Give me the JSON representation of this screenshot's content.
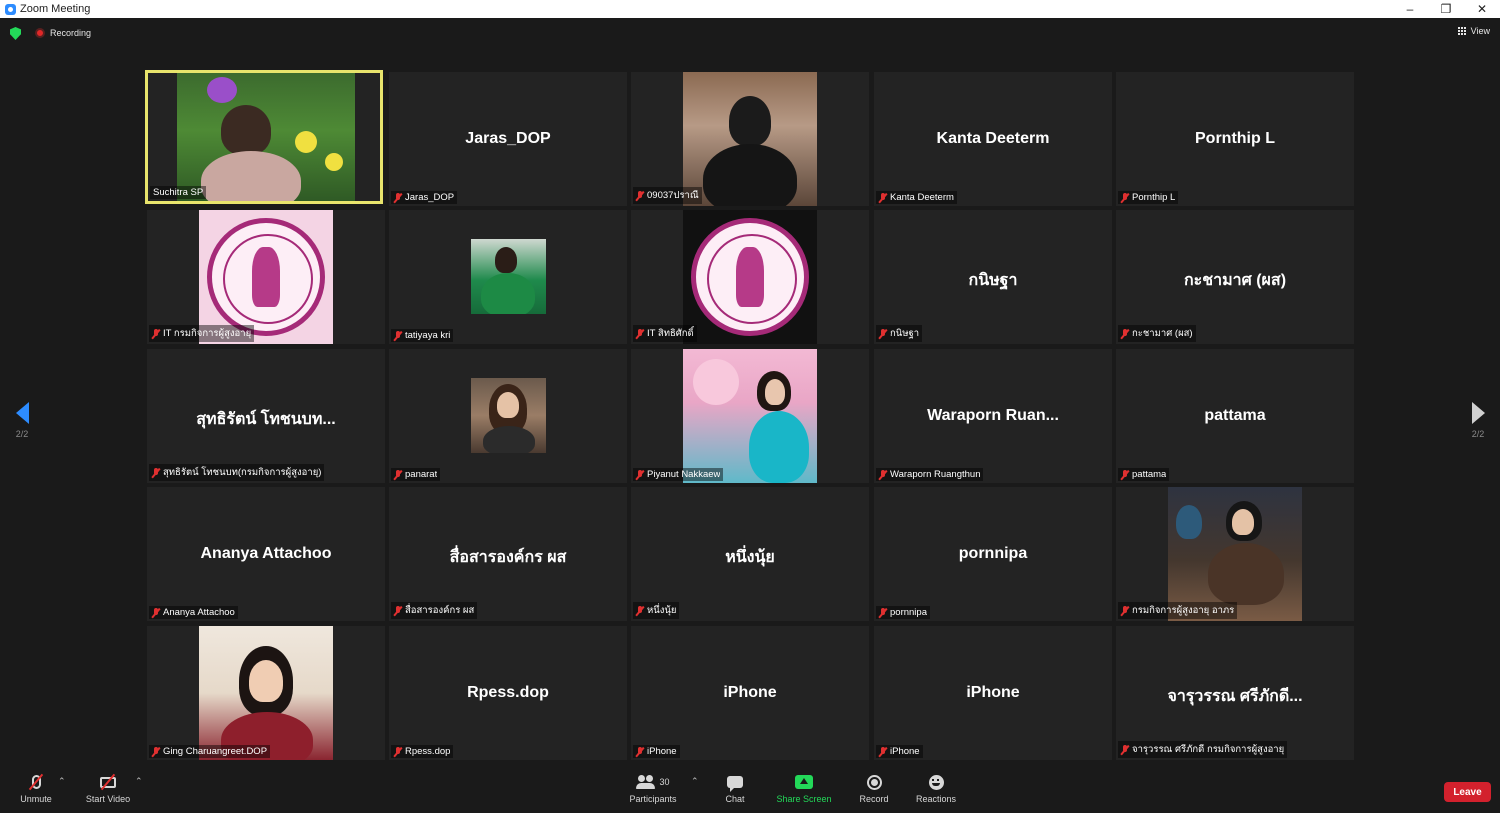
{
  "window": {
    "title": "Zoom Meeting",
    "minimize": "–",
    "maximize": "❐",
    "close": "✕"
  },
  "topbar": {
    "recording_label": "Recording",
    "view_label": "View"
  },
  "pager": {
    "page": "2/2"
  },
  "tiles": [
    {
      "display": "",
      "name": "Suchitra SP"
    },
    {
      "display": "Jaras_DOP",
      "name": "Jaras_DOP"
    },
    {
      "display": "",
      "name": "09037ปราณี"
    },
    {
      "display": "Kanta Deeterm",
      "name": "Kanta Deeterm"
    },
    {
      "display": "Pornthip L",
      "name": "Pornthip L"
    },
    {
      "display": "",
      "name": "IT กรมกิจการผู้สูงอายุ"
    },
    {
      "display": "",
      "name": "tatiyaya kri"
    },
    {
      "display": "",
      "name": "IT สิทธิศักดิ์"
    },
    {
      "display": "กนิษฐา",
      "name": "กนิษฐา"
    },
    {
      "display": "กะชามาศ (ผส)",
      "name": "กะชามาศ (ผส)"
    },
    {
      "display": "สุทธิรัตน์ โทชนบท...",
      "name": "สุทธิรัตน์ โทชนบท(กรมกิจการผู้สูงอายุ)"
    },
    {
      "display": "",
      "name": "panarat"
    },
    {
      "display": "",
      "name": "Piyanut Nakkaew"
    },
    {
      "display": "Waraporn Ruan...",
      "name": "Waraporn Ruangthun"
    },
    {
      "display": "pattama",
      "name": "pattama"
    },
    {
      "display": "Ananya Attachoo",
      "name": "Ananya Attachoo"
    },
    {
      "display": "สื่อสารองค์กร ผส",
      "name": "สื่อสารองค์กร ผส"
    },
    {
      "display": "หนึ่งนุ้ย",
      "name": "หนึ่งนุ้ย"
    },
    {
      "display": "pornnipa",
      "name": "pornnipa"
    },
    {
      "display": "",
      "name": "กรมกิจการผู้สูงอายุ อาภร"
    },
    {
      "display": "",
      "name": "Ging Charuangreet.DOP"
    },
    {
      "display": "Rpess.dop",
      "name": "Rpess.dop"
    },
    {
      "display": "iPhone",
      "name": "iPhone"
    },
    {
      "display": "iPhone",
      "name": "iPhone"
    },
    {
      "display": "จารุวรรณ ศรีภักดี...",
      "name": "จารุวรรณ ศรีภักดี กรมกิจการผู้สูงอายุ"
    }
  ],
  "toolbar": {
    "unmute": "Unmute",
    "start_video": "Start Video",
    "participants": "Participants",
    "participants_count": "30",
    "chat": "Chat",
    "share_screen": "Share Screen",
    "record": "Record",
    "reactions": "Reactions",
    "leave": "Leave"
  },
  "colors": {
    "active_speaker": "#e8e46c",
    "share_green": "#23d959",
    "leave_red": "#d3212d",
    "accent_blue": "#2d8cff"
  }
}
